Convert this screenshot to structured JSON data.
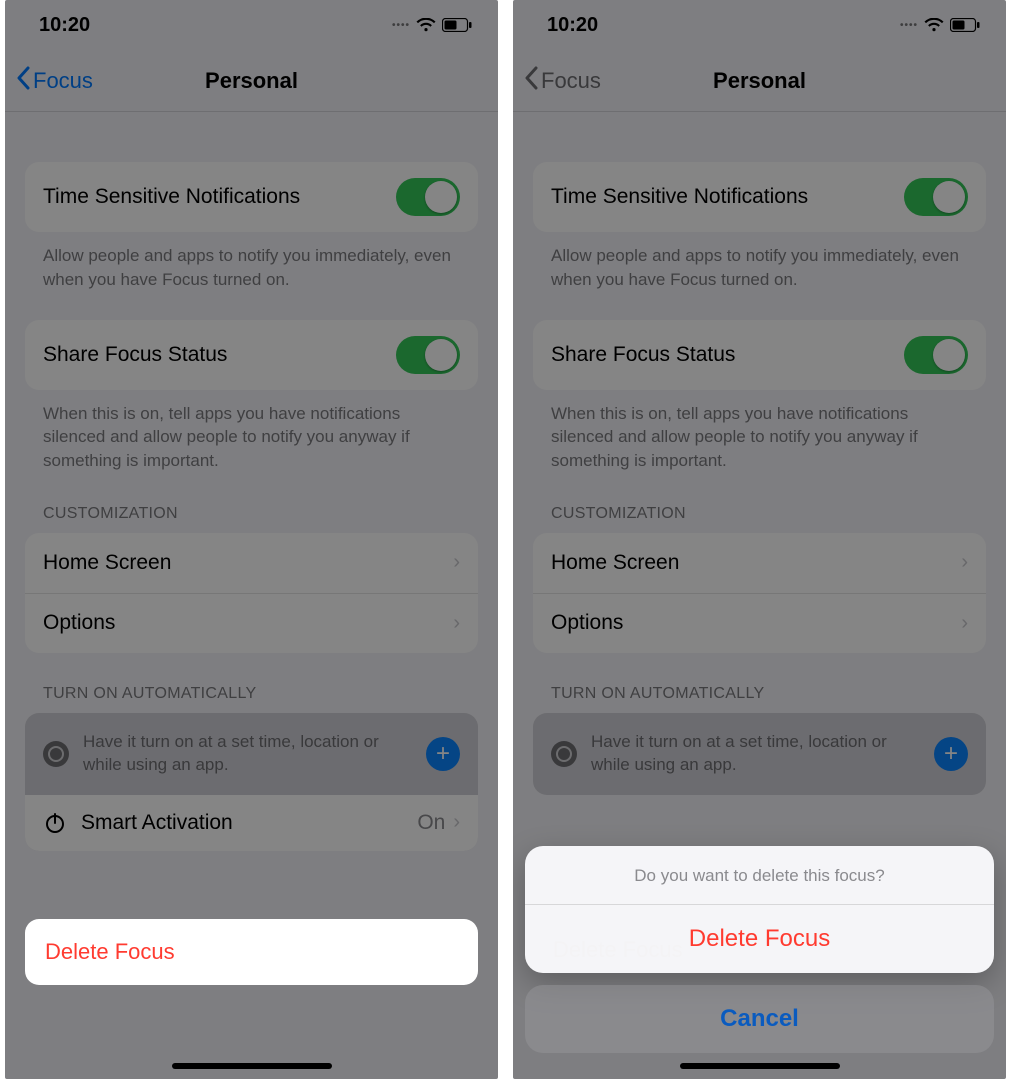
{
  "status": {
    "time": "10:20"
  },
  "nav": {
    "back": "Focus",
    "title": "Personal"
  },
  "timeSensitive": {
    "label": "Time Sensitive Notifications",
    "footer": "Allow people and apps to notify you immediately, even when you have Focus turned on."
  },
  "shareStatus": {
    "label": "Share Focus Status",
    "footer": "When this is on, tell apps you have notifications silenced and allow people to notify you anyway if something is important."
  },
  "customization": {
    "header": "CUSTOMIZATION",
    "homeScreen": "Home Screen",
    "options": "Options"
  },
  "auto": {
    "header": "TURN ON AUTOMATICALLY",
    "desc": "Have it turn on at a set time, location or while using an app.",
    "smart": "Smart Activation",
    "smartValue": "On"
  },
  "delete": {
    "label": "Delete Focus"
  },
  "sheet": {
    "title": "Do you want to delete this focus?",
    "action": "Delete Focus",
    "cancel": "Cancel"
  }
}
